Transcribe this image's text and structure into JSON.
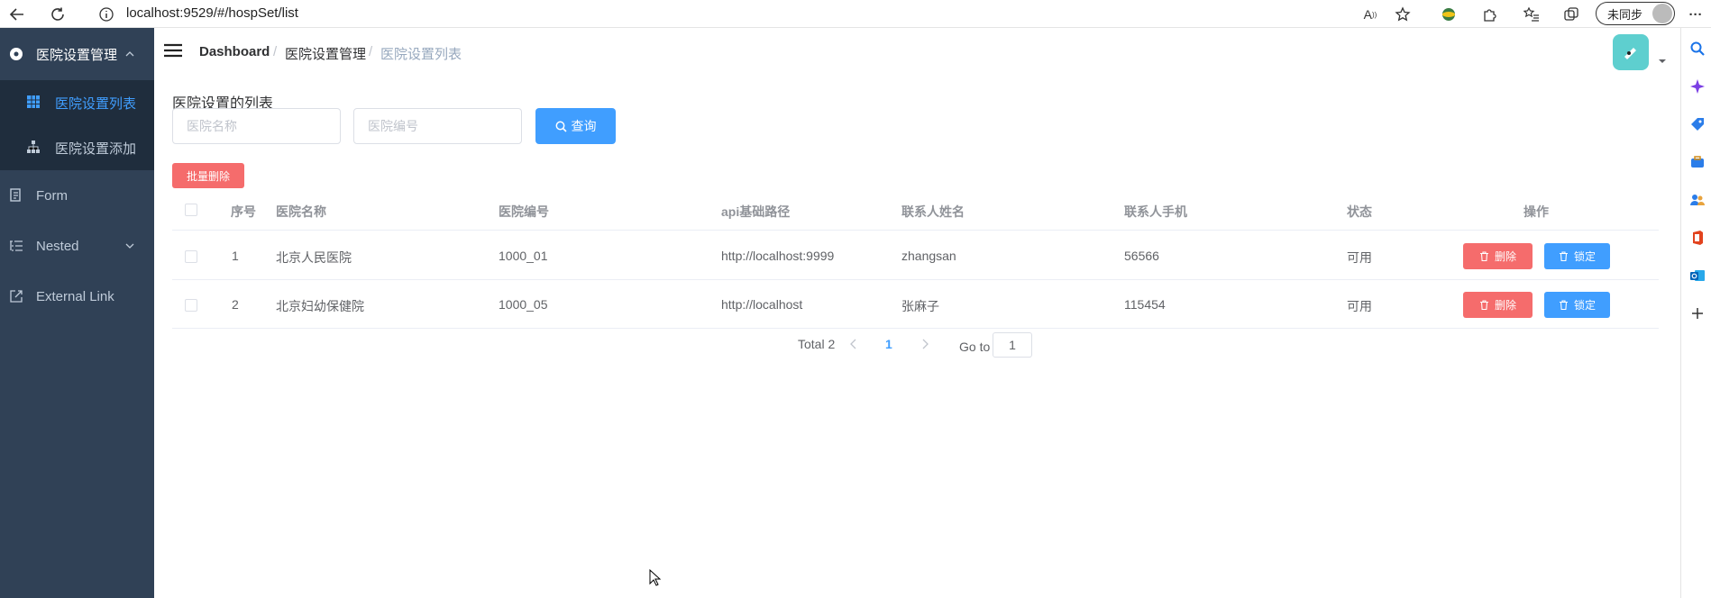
{
  "browser": {
    "url": "localhost:9529/#/hospSet/list",
    "sync_label": "未同步"
  },
  "sidebar": {
    "group_title": "医院设置管理",
    "items": [
      {
        "label": "医院设置列表",
        "active": true
      },
      {
        "label": "医院设置添加",
        "active": false
      }
    ],
    "form_label": "Form",
    "nested_label": "Nested",
    "external_label": "External Link"
  },
  "breadcrumb": {
    "home": "Dashboard",
    "section": "医院设置管理",
    "current": "医院设置列表"
  },
  "page": {
    "title": "医院设置的列表",
    "search": {
      "name_placeholder": "医院名称",
      "code_placeholder": "医院编号",
      "query_label": "查询"
    },
    "batch_delete_label": "批量删除"
  },
  "table": {
    "columns": [
      "序号",
      "医院名称",
      "医院编号",
      "api基础路径",
      "联系人姓名",
      "联系人手机",
      "状态",
      "操作"
    ],
    "rows": [
      {
        "index": "1",
        "name": "北京人民医院",
        "code": "1000_01",
        "api": "http://localhost:9999",
        "contact": "zhangsan",
        "phone": "56566",
        "status": "可用"
      },
      {
        "index": "2",
        "name": "北京妇幼保健院",
        "code": "1000_05",
        "api": "http://localhost",
        "contact": "张麻子",
        "phone": "115454",
        "status": "可用"
      }
    ],
    "delete_label": "删除",
    "lock_label": "锁定"
  },
  "pagination": {
    "total": "Total 2",
    "current_page": "1",
    "goto_label": "Go to",
    "goto_value": "1"
  },
  "colors": {
    "sidebar_bg": "#304156",
    "sidebar_active": "#409eff",
    "primary": "#409eff",
    "danger": "#f56c6c"
  }
}
